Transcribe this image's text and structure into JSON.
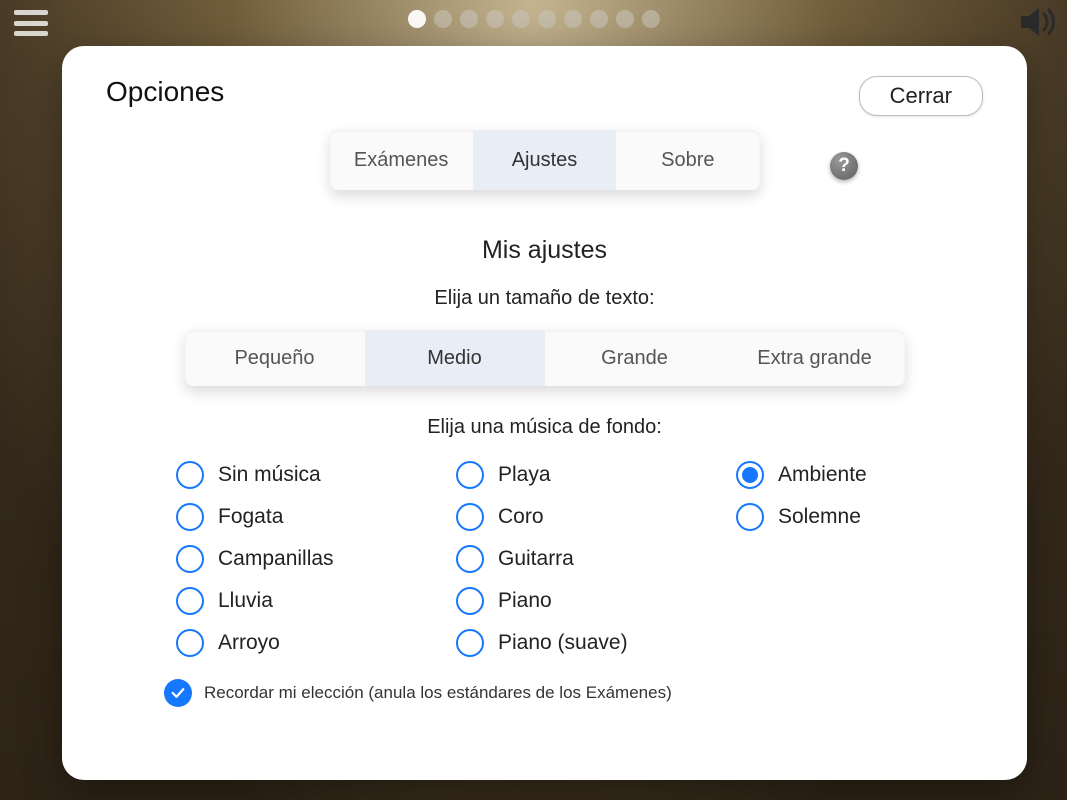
{
  "header": {
    "title": "Opciones",
    "close_label": "Cerrar",
    "tabs": [
      "Exámenes",
      "Ajustes",
      "Sobre"
    ],
    "active_tab": 1
  },
  "settings": {
    "section_title": "Mis ajustes",
    "text_size_prompt": "Elija un tamaño de texto:",
    "text_sizes": [
      "Pequeño",
      "Medio",
      "Grande",
      "Extra grande"
    ],
    "selected_text_size": 1,
    "music_prompt": "Elija una música de fondo:",
    "music_columns": [
      [
        "Sin música",
        "Fogata",
        "Campanillas",
        "Lluvia",
        "Arroyo"
      ],
      [
        "Playa",
        "Coro",
        "Guitarra",
        "Piano",
        "Piano (suave)"
      ],
      [
        "Ambiente",
        "Solemne"
      ]
    ],
    "selected_music": "Ambiente",
    "remember_label": "Recordar mi elección (anula los estándares de los Exámenes)",
    "remember_checked": true
  },
  "progress": {
    "dots": 10,
    "active": 0
  }
}
